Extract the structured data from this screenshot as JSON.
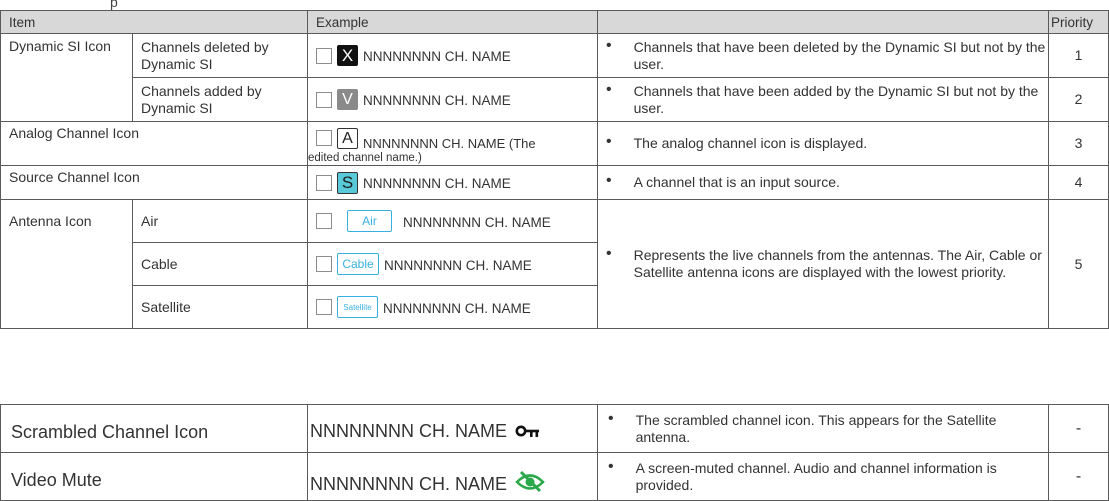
{
  "header": {
    "item": "Item",
    "example": "Example",
    "priority": "Priority",
    "cut_title": "p"
  },
  "rows": {
    "dynamic_si": {
      "item": "Dynamic SI Icon",
      "deleted": {
        "sub": "Channels deleted by Dynamic SI",
        "icon_letter": "X",
        "name": "NNNNNNNN CH. NAME",
        "desc": "Channels that have been deleted by the Dynamic SI but not by the user.",
        "priority": "1"
      },
      "added": {
        "sub": "Channels added by Dynamic SI",
        "icon_letter": "V",
        "name": "NNNNNNNN CH. NAME",
        "desc": "Channels that have been added by the Dynamic SI but not by the user.",
        "priority": "2"
      }
    },
    "analog": {
      "item": "Analog Channel Icon",
      "icon_letter": "A",
      "name": "NNNNNNNN CH. NAME (The",
      "name_cont": "edited channel name.)",
      "desc": "The analog channel icon is displayed.",
      "priority": "3"
    },
    "source": {
      "item": "Source Channel Icon",
      "icon_letter": "S",
      "name": "NNNNNNNN CH. NAME",
      "desc": "A channel that is an input source.",
      "priority": "4"
    },
    "antenna": {
      "item": "Antenna Icon",
      "desc": "Represents the live channels from the antennas. The Air, Cable or Satellite antenna icons are displayed with the lowest priority.",
      "priority": "5",
      "air": {
        "sub": "Air",
        "icon_label": "Air",
        "name": "NNNNNNNN CH. NAME"
      },
      "cable": {
        "sub": "Cable",
        "icon_label": "Cable",
        "name": "NNNNNNNN CH. NAME"
      },
      "satellite": {
        "sub": "Satellite",
        "icon_label": "Satellite",
        "name": "NNNNNNNN CH. NAME"
      }
    },
    "scrambled": {
      "item": "Scrambled Channel Icon",
      "name": "NNNNNNNN CH. NAME",
      "icon": "key-icon",
      "desc": "The scrambled channel icon. This appears for the Satellite antenna.",
      "priority": "-"
    },
    "video_mute": {
      "item": "Video Mute",
      "name": "NNNNNNNN CH. NAME",
      "icon": "eye-slash-icon",
      "icon_color": "#2aa84a",
      "desc": "A screen-muted channel. Audio and channel information is provided.",
      "priority": "-"
    }
  }
}
